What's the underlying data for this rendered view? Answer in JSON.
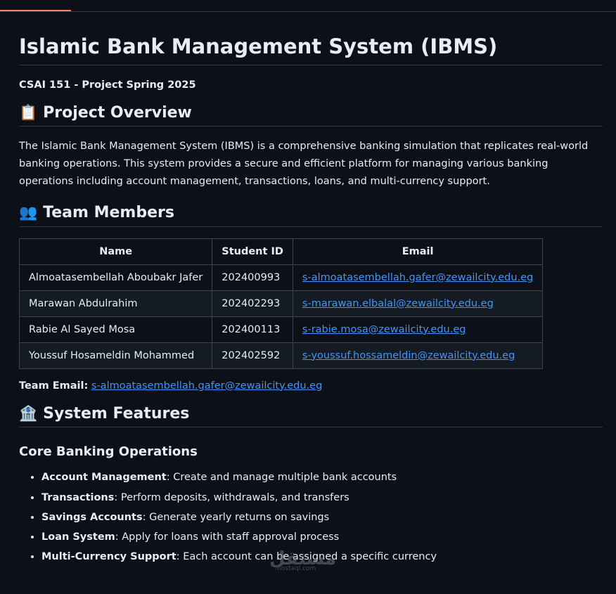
{
  "title": "Islamic Bank Management System (IBMS)",
  "subtitle": "CSAI 151 - Project Spring 2025",
  "overview": {
    "icon": "📋",
    "heading": "Project Overview",
    "text": "The Islamic Bank Management System (IBMS) is a comprehensive banking simulation that replicates real-world banking operations. This system provides a secure and efficient platform for managing various banking operations including account management, transactions, loans, and multi-currency support."
  },
  "team": {
    "icon": "👥",
    "heading": "Team Members",
    "columns": [
      "Name",
      "Student ID",
      "Email"
    ],
    "rows": [
      {
        "name": "Almoatasembellah Aboubakr Jafer",
        "id": "202400993",
        "email": "s-almoatasembellah.gafer@zewailcity.edu.eg"
      },
      {
        "name": "Marawan Abdulrahim",
        "id": "202402293",
        "email": "s-marawan.elbalal@zewailcity.edu.eg"
      },
      {
        "name": "Rabie Al Sayed Mosa",
        "id": "202400113",
        "email": "s-rabie.mosa@zewailcity.edu.eg"
      },
      {
        "name": "Youssuf Hosameldin Mohammed",
        "id": "202402592",
        "email": "s-youssuf.hossameldin@zewailcity.edu.eg"
      }
    ],
    "team_email_label": "Team Email:",
    "team_email": "s-almoatasembellah.gafer@zewailcity.edu.eg"
  },
  "features": {
    "icon": "🏦",
    "heading": "System Features",
    "subheading": "Core Banking Operations",
    "items": [
      {
        "label": "Account Management",
        "desc": ": Create and manage multiple bank accounts"
      },
      {
        "label": "Transactions",
        "desc": ": Perform deposits, withdrawals, and transfers"
      },
      {
        "label": "Savings Accounts",
        "desc": ": Generate yearly returns on savings"
      },
      {
        "label": "Loan System",
        "desc": ": Apply for loans with staff approval process"
      },
      {
        "label": "Multi-Currency Support",
        "desc": ": Each account can be assigned a specific currency"
      }
    ]
  },
  "watermark": {
    "main": "مستقل",
    "sub": "mostaql.com"
  }
}
